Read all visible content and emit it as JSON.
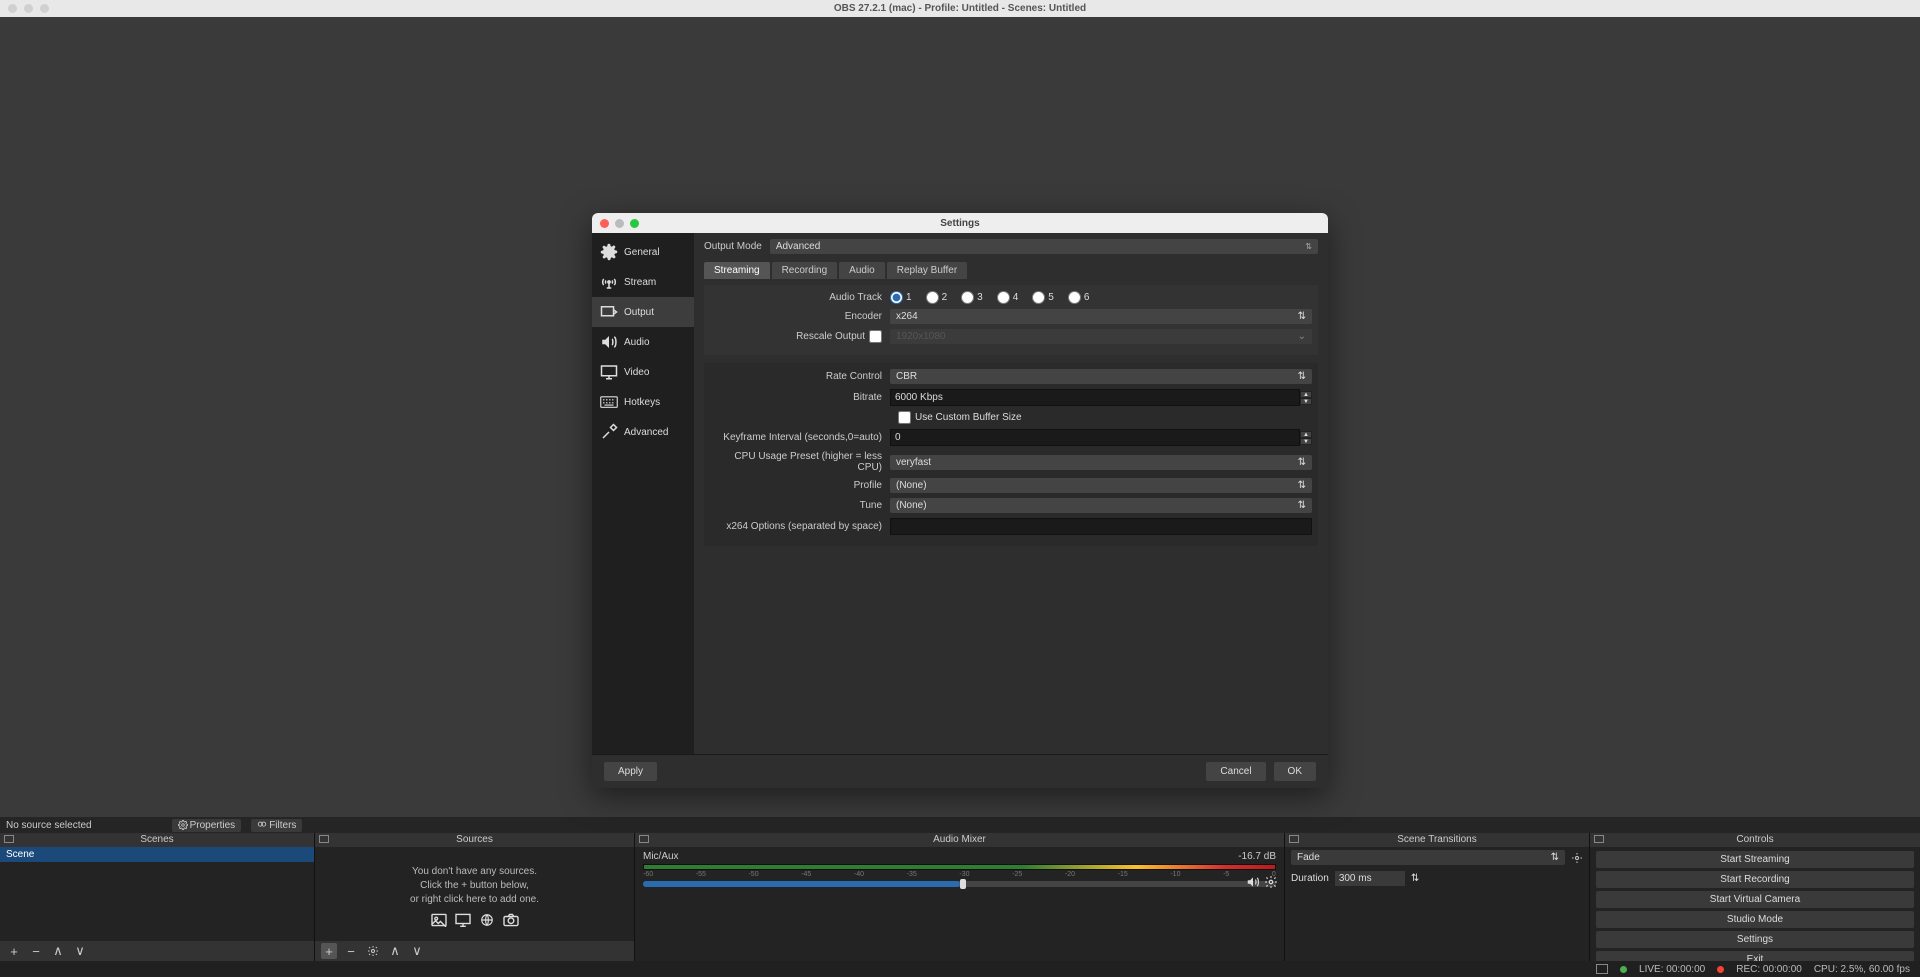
{
  "title": "OBS 27.2.1 (mac) - Profile: Untitled - Scenes: Untitled",
  "toolbar": {
    "no_source": "No source selected",
    "properties": "Properties",
    "filters": "Filters"
  },
  "docks": {
    "scenes": {
      "title": "Scenes",
      "item": "Scene"
    },
    "sources": {
      "title": "Sources",
      "hint1": "You don't have any sources.",
      "hint2": "Click the + button below,",
      "hint3": "or right click here to add one."
    },
    "mixer": {
      "title": "Audio Mixer",
      "channel": "Mic/Aux",
      "db": "-16.7 dB",
      "ticks": [
        "-60",
        "-55",
        "-50",
        "-45",
        "-40",
        "-35",
        "-30",
        "-25",
        "-20",
        "-15",
        "-10",
        "-5",
        "0"
      ]
    },
    "transitions": {
      "title": "Scene Transitions",
      "effect": "Fade",
      "duration_label": "Duration",
      "duration_value": "300 ms"
    },
    "controls": {
      "title": "Controls",
      "buttons": [
        "Start Streaming",
        "Start Recording",
        "Start Virtual Camera",
        "Studio Mode",
        "Settings",
        "Exit"
      ]
    }
  },
  "status": {
    "live": "LIVE: 00:00:00",
    "rec": "REC: 00:00:00",
    "cpu": "CPU: 2.5%, 60.00 fps"
  },
  "dialog": {
    "title": "Settings",
    "sidebar": [
      "General",
      "Stream",
      "Output",
      "Audio",
      "Video",
      "Hotkeys",
      "Advanced"
    ],
    "output_mode_label": "Output Mode",
    "output_mode_value": "Advanced",
    "tabs": [
      "Streaming",
      "Recording",
      "Audio",
      "Replay Buffer"
    ],
    "audio_track_label": "Audio Track",
    "tracks": [
      "1",
      "2",
      "3",
      "4",
      "5",
      "6"
    ],
    "encoder_label": "Encoder",
    "encoder_value": "x264",
    "rescale_label": "Rescale Output",
    "rescale_value": "1920x1080",
    "rate_label": "Rate Control",
    "rate_value": "CBR",
    "bitrate_label": "Bitrate",
    "bitrate_value": "6000 Kbps",
    "custom_buffer": "Use Custom Buffer Size",
    "keyframe_label": "Keyframe Interval (seconds,0=auto)",
    "keyframe_value": "0",
    "cpu_label": "CPU Usage Preset (higher = less CPU)",
    "cpu_value": "veryfast",
    "profile_label": "Profile",
    "profile_value": "(None)",
    "tune_label": "Tune",
    "tune_value": "(None)",
    "x264_label": "x264 Options (separated by space)",
    "buttons": {
      "apply": "Apply",
      "cancel": "Cancel",
      "ok": "OK"
    }
  }
}
